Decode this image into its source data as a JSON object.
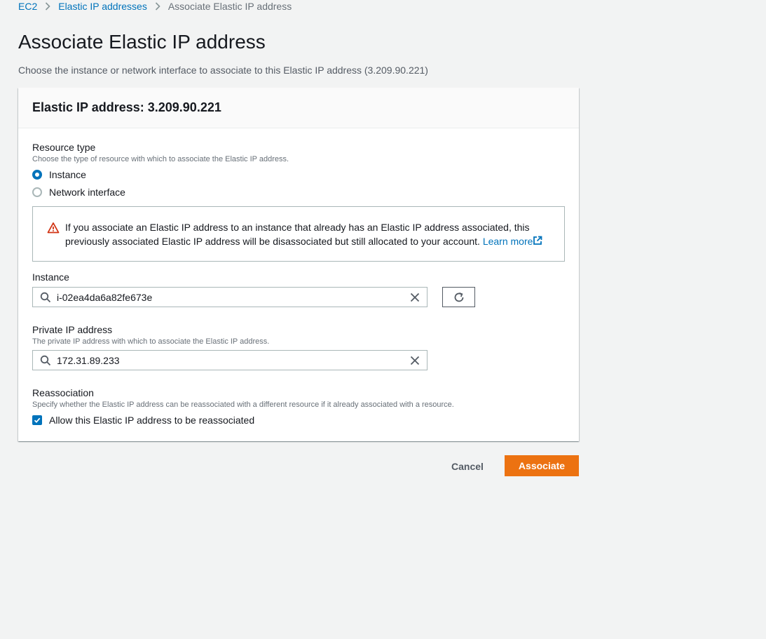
{
  "breadcrumb": {
    "items": [
      {
        "label": "EC2"
      },
      {
        "label": "Elastic IP addresses"
      },
      {
        "label": "Associate Elastic IP address"
      }
    ]
  },
  "page": {
    "title": "Associate Elastic IP address",
    "description": "Choose the instance or network interface to associate to this Elastic IP address (3.209.90.221)"
  },
  "panel": {
    "title": "Elastic IP address: 3.209.90.221"
  },
  "resource_type": {
    "label": "Resource type",
    "hint": "Choose the type of resource with which to associate the Elastic IP address.",
    "options": [
      {
        "label": "Instance",
        "selected": true
      },
      {
        "label": "Network interface",
        "selected": false
      }
    ]
  },
  "alert": {
    "icon": "warning-icon",
    "line1": "If you associate an Elastic IP address to an instance that already has an Elastic IP address associated, this",
    "line2": "previously associated Elastic IP address will be disassociated but still allocated to your account.",
    "link": "Learn more"
  },
  "instance": {
    "label": "Instance",
    "value": "i-02ea4da6a82fe673e"
  },
  "private_ip": {
    "label": "Private IP address",
    "hint": "The private IP address with which to associate the Elastic IP address.",
    "value": "172.31.89.233"
  },
  "reassociation": {
    "label": "Reassociation",
    "hint": "Specify whether the Elastic IP address can be reassociated with a different resource if it already associated with a resource.",
    "checkbox_label": "Allow this Elastic IP address to be reassociated",
    "checked": true
  },
  "actions": {
    "cancel": "Cancel",
    "associate": "Associate"
  },
  "colors": {
    "accent": "#0073bb",
    "primary_button": "#ec7211",
    "warning": "#d13212"
  }
}
